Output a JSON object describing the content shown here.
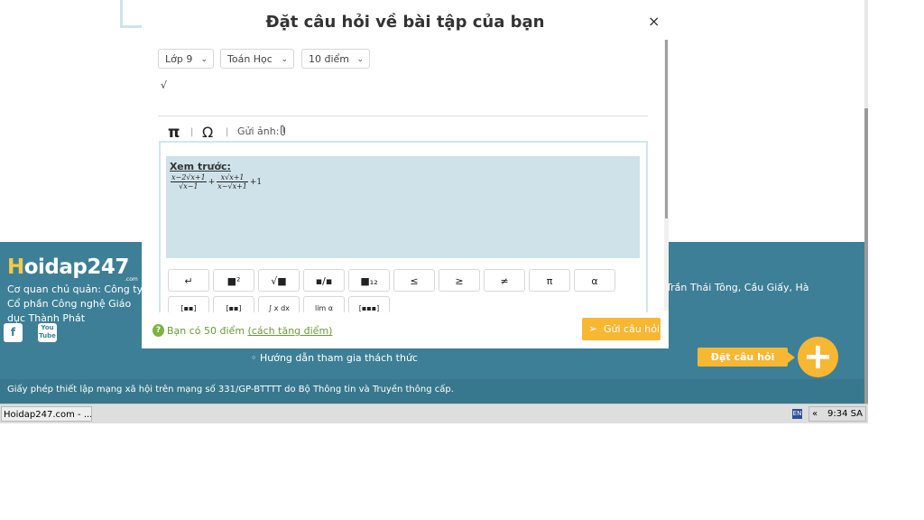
{
  "modal": {
    "title": "Đặt câu hỏi về bài tập của bạn",
    "close": "×",
    "selects": [
      {
        "value": "Lớp 9"
      },
      {
        "value": "Toán Học"
      },
      {
        "value": "10 điểm"
      }
    ],
    "editor_text": "√",
    "toolbar": {
      "pi": "π",
      "omega": "Ω",
      "separator": "|",
      "attach_label": "Gửi ảnh:",
      "attach_icon": "paperclip-icon"
    },
    "preview": {
      "label": "Xem trước:",
      "f1_num": "x−2√x+1",
      "f1_den": "√x−1",
      "op_plus": "+",
      "f2_num": "x√x+1",
      "f2_den": "x−√x+1",
      "tail": "+1"
    },
    "symbols_row1": [
      "↵",
      "■²",
      "√■",
      "▪/▪",
      "■₁₂",
      "≤",
      "≥",
      "≠",
      "π",
      "α"
    ],
    "symbols_row2": [
      "[▪▪]",
      "[▪▪]",
      "∫ x dx",
      "lim α",
      "[▪▪▪]"
    ],
    "points_text": "Bạn có 50 điểm",
    "points_link": "(cách tăng điểm)",
    "send_label": "Gửi câu hỏi"
  },
  "footer": {
    "logo_main": "oidap247",
    "logo_h": "H",
    "logo_suffix": ".com",
    "company": "Cơ quan chủ quản: Công ty Cổ phần Công nghệ Giáo dục Thành Phát",
    "address_fragment": "Trần Thái Tông, Cầu Giấy, Hà",
    "guide_link": "◦ Hướng dẫn tham gia thách thức",
    "license": "Giấy phép thiết lập mạng xã hội trên mạng số 331/GP-BTTTT do Bộ Thông tin và Truyền thông cấp.",
    "ask_button": "Đặt câu hỏi",
    "plus": "+",
    "facebook": "f",
    "youtube": "You Tube"
  },
  "taskbar": {
    "window_label": "Hoidap247.com - ...",
    "lang": "EN",
    "chevron": "«",
    "time": "9:34 SA"
  },
  "colors": {
    "footer_bg": "#3d7f96",
    "accent": "#f7b733",
    "preview_bg": "#cfe2e9",
    "points_green": "#6a9a3a"
  }
}
